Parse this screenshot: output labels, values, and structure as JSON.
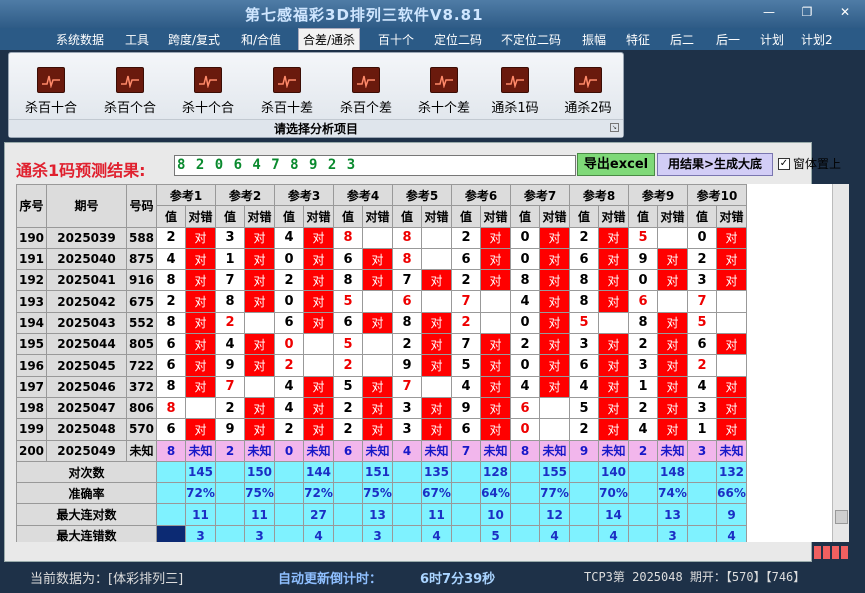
{
  "window": {
    "title": "第七感福彩3D排列三软件V8.81",
    "minimize": "—",
    "restore": "❐",
    "close": "✕"
  },
  "menu": [
    {
      "label": "系统数据",
      "active": false
    },
    {
      "label": "工具",
      "active": false
    },
    {
      "label": "跨度/复式",
      "active": false
    },
    {
      "label": "和/合值",
      "active": false
    },
    {
      "label": "合差/通杀",
      "active": true
    },
    {
      "label": "百十个",
      "active": false
    },
    {
      "label": "定位二码",
      "active": false
    },
    {
      "label": "不定位二码",
      "active": false
    },
    {
      "label": "振幅",
      "active": false
    },
    {
      "label": "特征",
      "active": false
    },
    {
      "label": "后二",
      "active": false
    },
    {
      "label": "后一",
      "active": false
    },
    {
      "label": "计划",
      "active": false
    },
    {
      "label": "计划2",
      "active": false
    }
  ],
  "ribbon": {
    "buttons": [
      "杀百十合",
      "杀百个合",
      "杀十个合",
      "杀百十差",
      "杀百个差",
      "杀十个差",
      "通杀1码",
      "通杀2码"
    ],
    "caption": "请选择分析项目",
    "icon": "chart-icon"
  },
  "prediction": {
    "label": "通杀1码预测结果:",
    "value": "8 2 0 6 4 7 8 9 2 3"
  },
  "actions": {
    "export": "导出excel",
    "generate": "用结果>生成大底",
    "topmost_label": "窗体置上",
    "topmost_checked": "✓"
  },
  "table": {
    "headers": {
      "seq": "序号",
      "period": "期号",
      "number": "号码",
      "val": "值",
      "cor": "对错"
    },
    "ref_names": [
      "参考1",
      "参考2",
      "参考3",
      "参考4",
      "参考5",
      "参考6",
      "参考7",
      "参考8",
      "参考9",
      "参考10"
    ],
    "mark_text": "对",
    "rows": [
      {
        "seq": "190",
        "period": "2025039",
        "number": "588",
        "vals": [
          "2",
          "3",
          "4",
          "8",
          "8",
          "2",
          "0",
          "2",
          "5",
          "0"
        ],
        "ok": [
          1,
          1,
          1,
          0,
          0,
          1,
          1,
          1,
          0,
          1
        ]
      },
      {
        "seq": "191",
        "period": "2025040",
        "number": "875",
        "vals": [
          "4",
          "1",
          "0",
          "6",
          "8",
          "6",
          "0",
          "6",
          "9",
          "2"
        ],
        "ok": [
          1,
          1,
          1,
          1,
          0,
          1,
          1,
          1,
          1,
          1
        ]
      },
      {
        "seq": "192",
        "period": "2025041",
        "number": "916",
        "vals": [
          "8",
          "7",
          "2",
          "8",
          "7",
          "2",
          "8",
          "8",
          "0",
          "3"
        ],
        "ok": [
          1,
          1,
          1,
          1,
          1,
          1,
          1,
          1,
          1,
          1
        ]
      },
      {
        "seq": "193",
        "period": "2025042",
        "number": "675",
        "vals": [
          "2",
          "8",
          "0",
          "5",
          "6",
          "7",
          "4",
          "8",
          "6",
          "7"
        ],
        "ok": [
          1,
          1,
          1,
          0,
          0,
          0,
          1,
          1,
          0,
          0
        ]
      },
      {
        "seq": "194",
        "period": "2025043",
        "number": "552",
        "vals": [
          "8",
          "2",
          "6",
          "6",
          "8",
          "2",
          "0",
          "5",
          "8",
          "5"
        ],
        "ok": [
          1,
          0,
          1,
          1,
          1,
          0,
          1,
          0,
          1,
          0
        ]
      },
      {
        "seq": "195",
        "period": "2025044",
        "number": "805",
        "vals": [
          "6",
          "4",
          "0",
          "5",
          "2",
          "7",
          "2",
          "3",
          "2",
          "6"
        ],
        "ok": [
          1,
          1,
          0,
          0,
          1,
          1,
          1,
          1,
          1,
          1
        ]
      },
      {
        "seq": "196",
        "period": "2025045",
        "number": "722",
        "vals": [
          "6",
          "9",
          "2",
          "2",
          "9",
          "5",
          "0",
          "6",
          "3",
          "2"
        ],
        "ok": [
          1,
          1,
          0,
          0,
          1,
          1,
          1,
          1,
          1,
          0
        ]
      },
      {
        "seq": "197",
        "period": "2025046",
        "number": "372",
        "vals": [
          "8",
          "7",
          "4",
          "5",
          "7",
          "4",
          "4",
          "4",
          "1",
          "4"
        ],
        "ok": [
          1,
          0,
          1,
          1,
          0,
          1,
          1,
          1,
          1,
          1
        ]
      },
      {
        "seq": "198",
        "period": "2025047",
        "number": "806",
        "vals": [
          "8",
          "2",
          "4",
          "2",
          "3",
          "9",
          "6",
          "5",
          "2",
          "3"
        ],
        "ok": [
          0,
          1,
          1,
          1,
          1,
          1,
          0,
          1,
          1,
          1
        ]
      },
      {
        "seq": "199",
        "period": "2025048",
        "number": "570",
        "vals": [
          "6",
          "9",
          "2",
          "2",
          "3",
          "6",
          "0",
          "2",
          "4",
          "1"
        ],
        "ok": [
          1,
          1,
          1,
          1,
          1,
          1,
          0,
          1,
          1,
          1
        ]
      }
    ],
    "current": {
      "seq": "200",
      "period": "2025049",
      "number": "未知",
      "vals": [
        "8",
        "2",
        "0",
        "6",
        "4",
        "7",
        "8",
        "9",
        "2",
        "3"
      ],
      "unknown": "未知"
    },
    "stats": [
      {
        "label": "对次数",
        "values": [
          "145",
          "150",
          "144",
          "151",
          "135",
          "128",
          "155",
          "140",
          "148",
          "132"
        ]
      },
      {
        "label": "准确率",
        "values": [
          "72%",
          "75%",
          "72%",
          "75%",
          "67%",
          "64%",
          "77%",
          "70%",
          "74%",
          "66%"
        ]
      },
      {
        "label": "最大连对数",
        "values": [
          "11",
          "11",
          "27",
          "13",
          "11",
          "10",
          "12",
          "14",
          "13",
          "9"
        ]
      },
      {
        "label": "最大连错数",
        "values": [
          "3",
          "3",
          "4",
          "3",
          "4",
          "5",
          "4",
          "4",
          "3",
          "4"
        ]
      }
    ]
  },
  "status": {
    "current_data": "当前数据为：[体彩排列三]",
    "countdown_label": "自动更新倒计时：",
    "countdown": "6时7分39秒",
    "last_draw": "TCP3第 2025048 期开：【570】【746】"
  },
  "colors": {
    "hit": "#ff0000",
    "current_row": "#f2b6ec",
    "stats_row": "#7ff2ff",
    "prediction_text": "#0a8a2e",
    "prediction_label": "#e0202e"
  }
}
